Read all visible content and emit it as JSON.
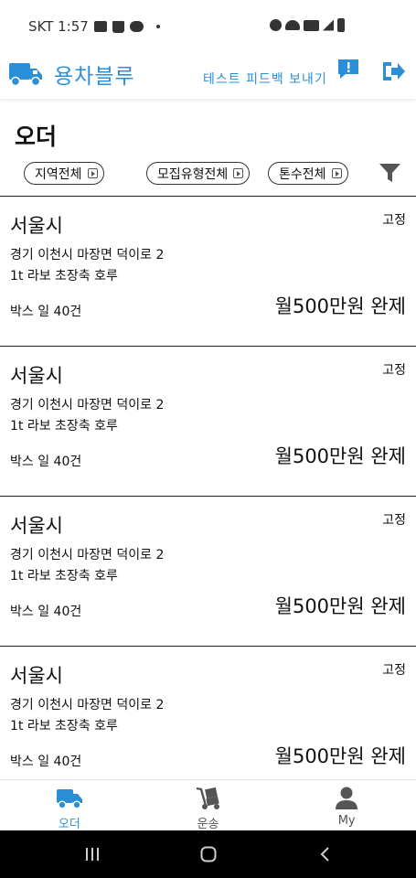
{
  "status_bar": {
    "carrier_time": "SKT 1:57",
    "icons": [
      "mail-icon",
      "shopping-bag-icon",
      "talk-icon",
      "dot-icon",
      "alarm-icon",
      "wifi-icon",
      "hd-voice-icon",
      "signal-icon",
      "battery-icon"
    ]
  },
  "header": {
    "app_title": "용차블루",
    "feedback_label": "테스트 피드백 보내기",
    "brand_color": "#2b8fd8"
  },
  "page": {
    "title": "오더",
    "filters": [
      {
        "label": "지역전체"
      },
      {
        "label": "모집유형전체"
      },
      {
        "label": "톤수전체"
      }
    ]
  },
  "orders": [
    {
      "region": "서울시",
      "type": "고정",
      "address": "경기 이천시 마장면 덕이로 2",
      "vehicle": "1t 라보 초장축 호루",
      "work": "박스 일 40건",
      "pay": "월500만원 완제"
    },
    {
      "region": "서울시",
      "type": "고정",
      "address": "경기 이천시 마장면 덕이로 2",
      "vehicle": "1t 라보 초장축 호루",
      "work": "박스 일 40건",
      "pay": "월500만원 완제"
    },
    {
      "region": "서울시",
      "type": "고정",
      "address": "경기 이천시 마장면 덕이로 2",
      "vehicle": "1t 라보 초장축 호루",
      "work": "박스 일 40건",
      "pay": "월500만원 완제"
    },
    {
      "region": "서울시",
      "type": "고정",
      "address": "경기 이천시 마장면 덕이로 2",
      "vehicle": "1t 라보 초장축 호루",
      "work": "박스 일 40건",
      "pay": "월500만원 완제"
    }
  ],
  "bottom_nav": {
    "tabs": [
      {
        "label": "오더",
        "icon": "truck-icon",
        "active": true
      },
      {
        "label": "운송",
        "icon": "hand-truck-icon",
        "active": false
      },
      {
        "label": "My",
        "icon": "person-icon",
        "active": false
      }
    ]
  },
  "system_nav": [
    "recent-apps-icon",
    "home-icon",
    "back-icon"
  ]
}
